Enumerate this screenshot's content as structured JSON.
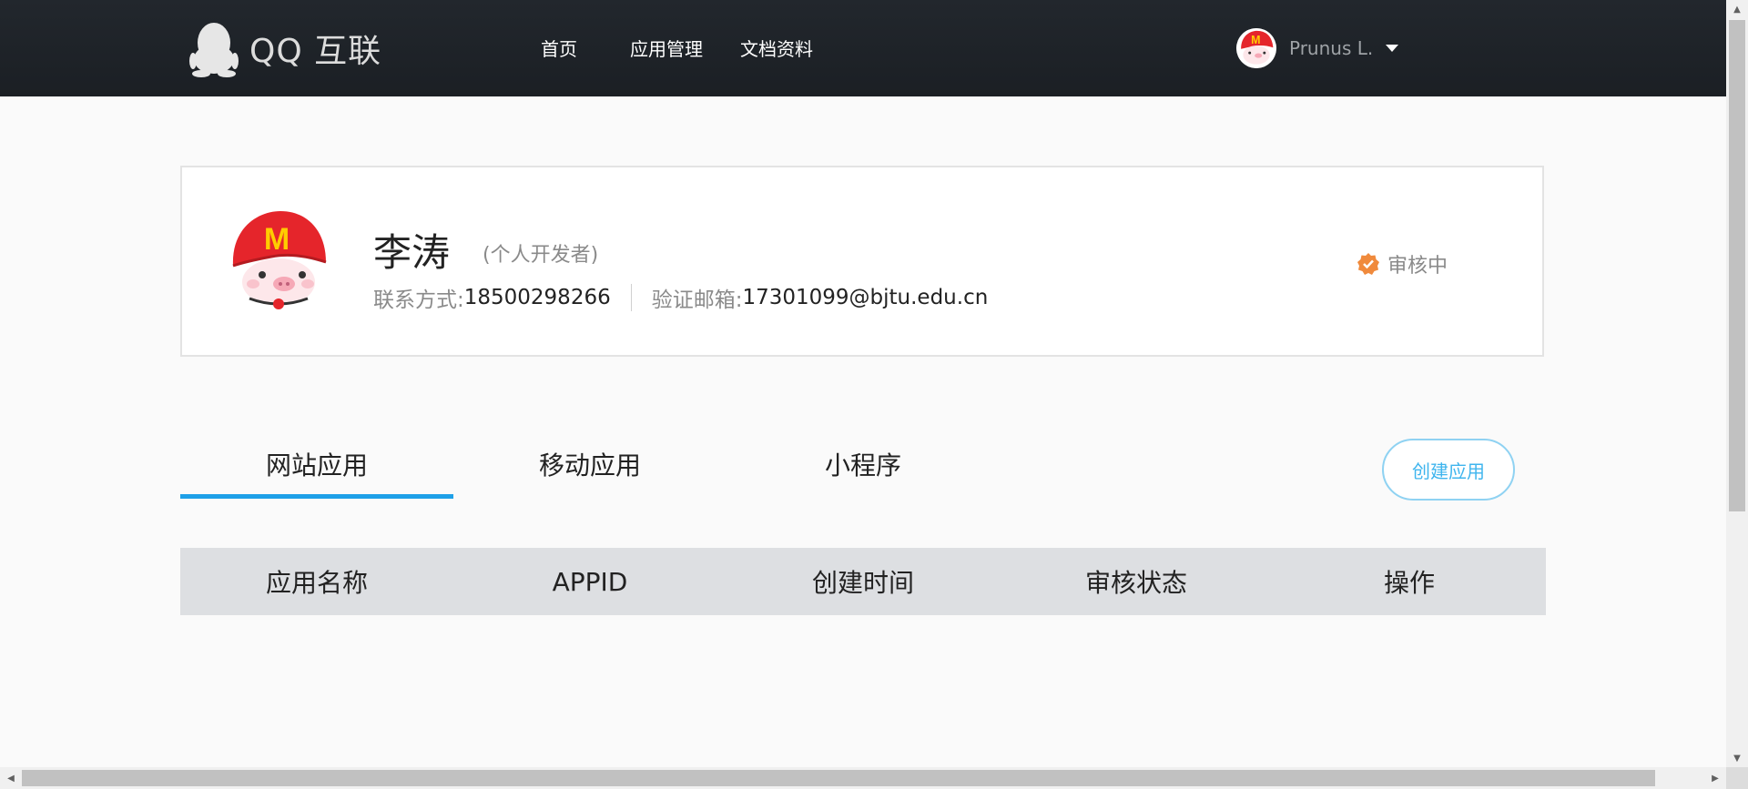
{
  "header": {
    "logo_text": "QQ 互联",
    "nav": [
      {
        "label": "首页"
      },
      {
        "label": "应用管理"
      },
      {
        "label": "文档资料"
      }
    ],
    "user_name": "Prunus L."
  },
  "profile": {
    "name": "李涛",
    "type": "(个人开发者)",
    "contact_label": "联系方式:",
    "contact_value": "18500298266",
    "email_label": "验证邮箱:",
    "email_value": "17301099@bjtu.edu.cn",
    "status": "审核中"
  },
  "tabs": [
    {
      "label": "网站应用",
      "active": true
    },
    {
      "label": "移动应用",
      "active": false
    },
    {
      "label": "小程序",
      "active": false
    }
  ],
  "create_button": "创建应用",
  "table": {
    "columns": [
      "应用名称",
      "APPID",
      "创建时间",
      "审核状态",
      "操作"
    ]
  },
  "colors": {
    "accent": "#1ea0e8",
    "status_badge": "#f08a3c",
    "header_bg": "#1e2227"
  }
}
